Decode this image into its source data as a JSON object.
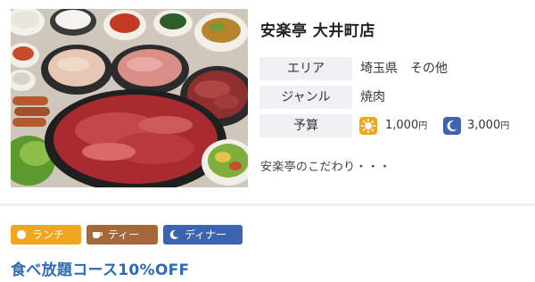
{
  "shop": {
    "name": "安楽亭 大井町店",
    "photo_alt": "焼肉の盛り合わせ"
  },
  "info": {
    "area_label": "エリア",
    "area_prefecture": "埼玉県",
    "area_city": "その他",
    "genre_label": "ジャンル",
    "genre_value": "焼肉",
    "budget_label": "予算",
    "budget_lunch": "1,000",
    "budget_dinner": "3,000",
    "budget_unit": "円"
  },
  "kodawari": "安楽亭のこだわり・・・",
  "tags": {
    "lunch": "ランチ",
    "tea": "ティー",
    "dinner": "ディナー"
  },
  "coupon": "食べ放題コース10%OFF",
  "colors": {
    "lunch": "#f2a51e",
    "tea": "#a5683a",
    "dinner": "#3c64b0",
    "coupon": "#2f6bb5",
    "label_bg": "#eef2f5"
  },
  "icons": {
    "lunch": "sun-icon",
    "tea": "cup-icon",
    "dinner": "moon-icon"
  }
}
